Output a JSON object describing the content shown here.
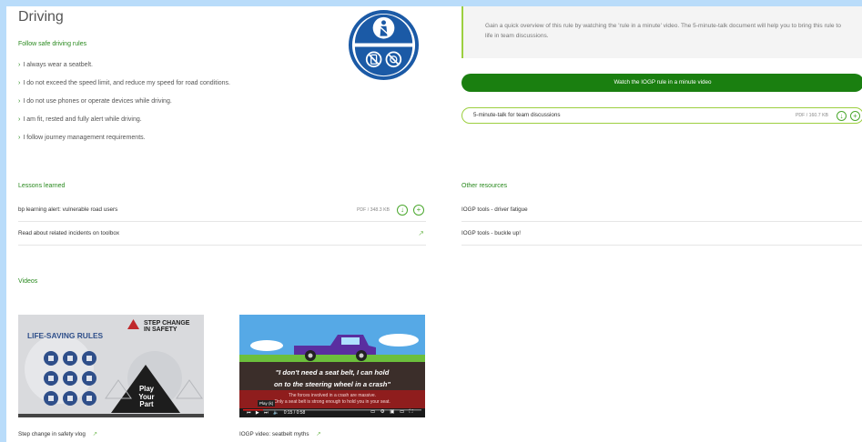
{
  "title": "Driving",
  "subtitle": "Follow safe driving rules",
  "rules": [
    "I always wear a seatbelt.",
    "I do not exceed the speed limit, and reduce my speed for road conditions.",
    "I do not use phones or operate devices while driving.",
    "I am fit, rested and fully alert while driving.",
    "I follow journey management requirements."
  ],
  "panel": {
    "text": "Gain a quick overview of this rule by watching the 'rule in a minute' video. The 5-minute-talk document will help you to bring this rule to life in team discussions."
  },
  "watch_button": "Watch the IOGP rule in a minute video",
  "talk": {
    "label": "5-minute-talk for team discussions",
    "meta": "PDF / 160.7 KB"
  },
  "lessons": {
    "heading": "Lessons learned",
    "items": [
      {
        "label": "bp learning alert: vulnerable road users",
        "meta": "PDF / 348.3 KB"
      },
      {
        "label": "Read about related incidents on toolbox",
        "meta": ""
      }
    ]
  },
  "other": {
    "heading": "Other resources",
    "items": [
      "IOGP tools - driver fatigue",
      "IOGP tools - buckle up!"
    ]
  },
  "videos": {
    "heading": "Videos",
    "items": [
      {
        "label": "Step change in safety vlog",
        "thumb_title": "LIFE-SAVING RULES",
        "brand_line1": "STEP CHANGE",
        "brand_line2": "IN SAFETY",
        "play_words": [
          "Play",
          "Your",
          "Part"
        ]
      },
      {
        "label": "IOGP video: seatbelt myths",
        "quote_line1": "\"I don't need a seat belt, I can hold",
        "quote_line2": "on to the steering wheel in a crash\"",
        "caption_line1": "The forces involved in a crash are massive.",
        "caption_line2": "Only a seat belt is strong enough to hold you in your seat.",
        "play_tooltip": "Play (k)",
        "time": "0:15 / 0:58"
      }
    ]
  },
  "colors": {
    "green": "#1a7f10",
    "accent": "#2a8a1f",
    "badge": "#1b5aa6",
    "border": "#9ccf3f"
  }
}
